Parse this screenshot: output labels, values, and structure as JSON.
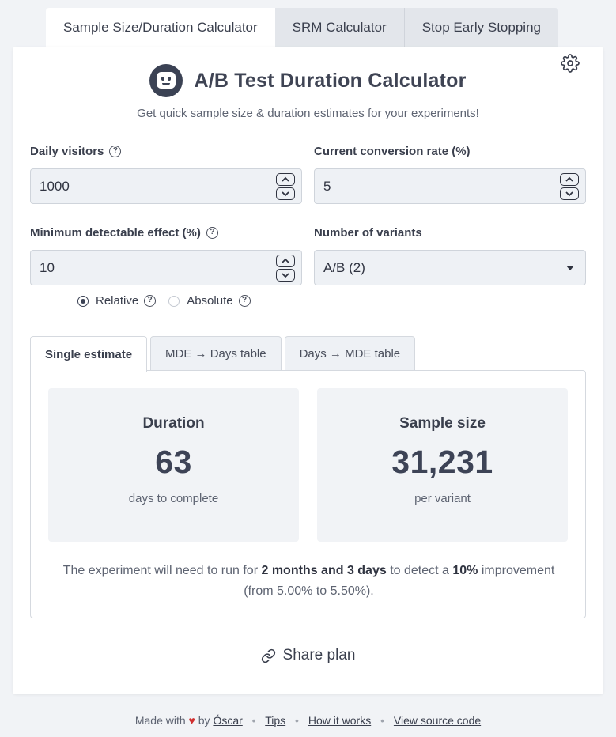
{
  "top_tabs": [
    {
      "label": "Sample Size/Duration Calculator",
      "active": true
    },
    {
      "label": "SRM Calculator",
      "active": false
    },
    {
      "label": "Stop Early Stopping",
      "active": false
    }
  ],
  "header": {
    "title": "A/B Test Duration Calculator",
    "subtitle": "Get quick sample size & duration estimates for your experiments!",
    "icons": {
      "logo": "robot-face-icon",
      "settings": "gear-icon"
    }
  },
  "form": {
    "daily_visitors": {
      "label": "Daily visitors",
      "value": "1000"
    },
    "conversion_rate": {
      "label": "Current conversion rate (%)",
      "value": "5"
    },
    "mde": {
      "label": "Minimum detectable effect (%)",
      "value": "10"
    },
    "variants": {
      "label": "Number of variants",
      "value": "A/B (2)"
    },
    "mde_type": {
      "relative": "Relative",
      "absolute": "Absolute",
      "selected": "Relative"
    },
    "help_glyph": "?"
  },
  "result_tabs": [
    {
      "label": "Single estimate",
      "active": true
    },
    {
      "label": "MDE → Days table",
      "active": false
    },
    {
      "label": "Days → MDE table",
      "active": false
    }
  ],
  "results": {
    "duration": {
      "title": "Duration",
      "value": "63",
      "sub": "days to complete"
    },
    "sample_size": {
      "title": "Sample size",
      "value": "31,231",
      "sub": "per variant"
    },
    "summary": {
      "prefix": "The experiment will need to run for ",
      "duration_text": "2 months and 3 days",
      "middle": " to detect a ",
      "effect": "10%",
      "suffix": " improvement (from 5.00% to 5.50%)."
    }
  },
  "share": {
    "label": "Share plan",
    "icon": "link-icon"
  },
  "footer": {
    "made_with": "Made with",
    "heart": "♥",
    "by": "by",
    "author": "Óscar",
    "links": [
      "Tips",
      "How it works",
      "View source code"
    ],
    "separator": "•"
  },
  "colors": {
    "accent": "#3b4254",
    "background": "#f1f3f6",
    "heart": "#d03030"
  }
}
